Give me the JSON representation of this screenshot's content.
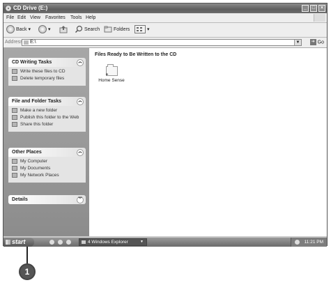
{
  "window": {
    "title": "CD Drive (E:)"
  },
  "menu": [
    "File",
    "Edit",
    "View",
    "Favorites",
    "Tools",
    "Help"
  ],
  "toolbar": {
    "back": "Back",
    "search": "Search",
    "folders": "Folders"
  },
  "address": {
    "label": "Address",
    "value": "E:\\",
    "go": "Go"
  },
  "tasks": [
    {
      "title": "CD Writing Tasks",
      "items": [
        "Write these files to CD",
        "Delete temporary files"
      ]
    },
    {
      "title": "File and Folder Tasks",
      "items": [
        "Make a new folder",
        "Publish this folder to the Web",
        "Share this folder"
      ]
    },
    {
      "title": "Other Places",
      "items": [
        "My Computer",
        "My Documents",
        "My Network Places"
      ]
    },
    {
      "title": "Details",
      "items": []
    }
  ],
  "content": {
    "heading": "Files Ready to Be Written to the CD",
    "folders": [
      "Home Sense"
    ]
  },
  "taskbar": {
    "start": "start",
    "group": "4 Windows Explorer",
    "clock": "11:21 PM"
  },
  "callout": "1"
}
